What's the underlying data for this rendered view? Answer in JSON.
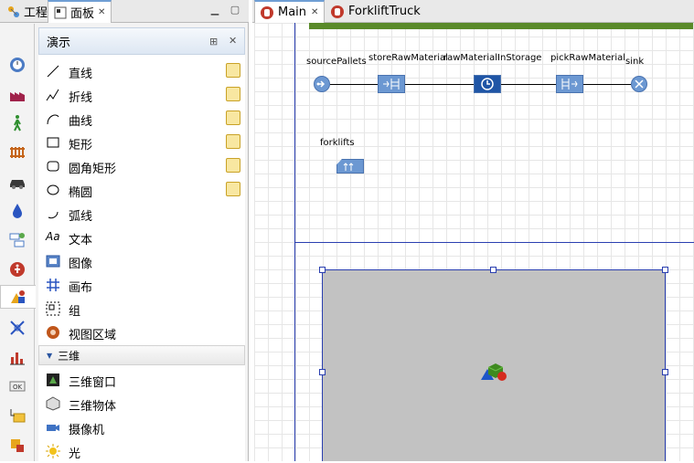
{
  "left_tabs": [
    {
      "label": "工程",
      "icon": "project-icon"
    },
    {
      "label": "面板",
      "icon": "palette-icon",
      "close": "✕"
    }
  ],
  "categories": [
    "timer-icon",
    "factory-icon",
    "pedestrian-icon",
    "rail-icon",
    "car-icon",
    "fluid-icon",
    "process-icon",
    "emergency-icon",
    "presentation-icon",
    "graph-icon",
    "chart-icon",
    "ok-icon",
    "folder-icon",
    "agent-icon"
  ],
  "palette": {
    "title": "演示",
    "items": [
      {
        "label": "直线",
        "icon": "line-icon",
        "editable": true
      },
      {
        "label": "折线",
        "icon": "polyline-icon",
        "editable": true
      },
      {
        "label": "曲线",
        "icon": "curve-icon",
        "editable": true
      },
      {
        "label": "矩形",
        "icon": "rectangle-icon",
        "editable": true
      },
      {
        "label": "圆角矩形",
        "icon": "rounded-rectangle-icon",
        "editable": true
      },
      {
        "label": "椭圆",
        "icon": "oval-icon",
        "editable": true
      },
      {
        "label": "弧线",
        "icon": "arc-icon",
        "editable": false
      },
      {
        "label": "文本",
        "icon": "text-icon",
        "editable": false,
        "glyph": "Aa"
      },
      {
        "label": "图像",
        "icon": "image-icon",
        "editable": false
      },
      {
        "label": "画布",
        "icon": "canvas-icon",
        "editable": false
      },
      {
        "label": "组",
        "icon": "group-icon",
        "editable": false
      },
      {
        "label": "视图区域",
        "icon": "view-area-icon",
        "editable": false
      }
    ],
    "section_3d": "三维",
    "items_3d": [
      {
        "label": "三维窗口",
        "icon": "3d-window-icon"
      },
      {
        "label": "三维物体",
        "icon": "3d-object-icon"
      },
      {
        "label": "摄像机",
        "icon": "camera-icon"
      },
      {
        "label": "光",
        "icon": "light-icon"
      }
    ]
  },
  "editor_tabs": [
    {
      "label": "Main",
      "active": true,
      "close": "✕"
    },
    {
      "label": "ForkliftTruck",
      "active": false
    }
  ],
  "diagram": {
    "blocks": [
      "sourcePallets",
      "storeRawMaterial",
      "rawMaterialInStorage",
      "pickRawMaterial",
      "sink"
    ],
    "resource": "forklifts"
  },
  "colors": {
    "frame": "#2a3fb0",
    "block": "#6c98d2",
    "block_dark": "#1f55a6",
    "preview": "#c2c2c2"
  }
}
